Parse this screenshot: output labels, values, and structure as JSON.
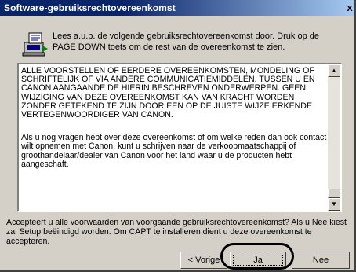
{
  "window": {
    "title": "Software-gebruiksrechtovereenkomst",
    "close_glyph": "x"
  },
  "header": {
    "icon": "computer-install-icon",
    "text": "Lees a.u.b. de volgende gebruiksrechtovereenkomst door. Druk op de PAGE DOWN  toets om de rest van de overeenkomst te zien."
  },
  "license": {
    "paragraph_1": "ALLE VOORSTELLEN OF EERDERE OVEREENKOMSTEN, MONDELING OF SCHRIFTELIJK OF VIA ANDERE COMMUNICATIEMIDDELEN, TUSSEN U EN CANON AANGAANDE DE HIERIN BESCHREVEN ONDERWERPEN. GEEN WIJZIGING VAN DEZE OVEREENKOMST KAN VAN KRACHT WORDEN ZONDER GETEKEND TE ZIJN DOOR EEN OP DE JUISTE WIJZE ERKENDE VERTEGENWOORDIGER VAN CANON.",
    "paragraph_2": "Als u nog vragen hebt over deze overeenkomst of om welke reden dan ook contact wilt opnemen met Canon, kunt u schrijven naar de verkoopmaatschappij of groothandelaar/dealer van Canon voor het land waar u de producten hebt aangeschaft."
  },
  "question": "Accepteert u alle voorwaarden van voorgaande gebruiksrechtovereenkomst? Als u Nee kiest zal Setup beëindigd worden. Om CAPT te installeren dient u deze overeenkomst te accepteren.",
  "buttons": {
    "back": "< Vorige",
    "yes": "Ja",
    "no": "Nee"
  },
  "colors": {
    "titlebar": "#0a246a",
    "dialog_face": "#d4d0c8",
    "highlight_ring": "#000000"
  }
}
